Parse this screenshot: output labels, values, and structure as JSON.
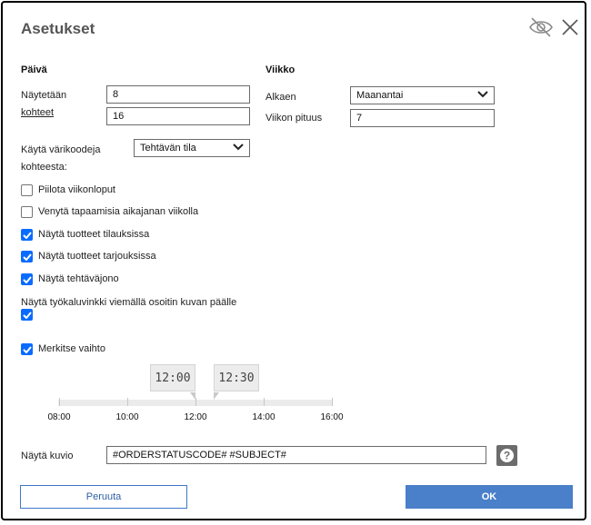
{
  "dialog": {
    "title": "Asetukset",
    "icons": {
      "hide": "eye-slash-icon",
      "close": "close-icon"
    }
  },
  "day": {
    "section": "Päivä",
    "shown_label_1": "Näytetään",
    "shown_label_2": "kohteet",
    "shown_value_1": "8",
    "shown_value_2": "16"
  },
  "week": {
    "section": "Viikko",
    "start_label": "Alkaen",
    "start_value": "Maanantai",
    "length_label": "Viikon pituus",
    "length_value": "7"
  },
  "colorcode": {
    "label_1": "Käytä värikoodeja",
    "label_2": "kohteesta:",
    "value": "Tehtävän tila"
  },
  "options": [
    {
      "label": "Piilota viikonloput",
      "checked": false
    },
    {
      "label": "Venytä tapaamisia aikajanan viikolla",
      "checked": false
    },
    {
      "label": "Näytä tuotteet tilauksissa",
      "checked": true
    },
    {
      "label": "Näytä tuotteet tarjouksissa",
      "checked": true
    },
    {
      "label": "Näytä tehtäväjono",
      "checked": true
    }
  ],
  "tooltip_option": {
    "label": "Näytä työkaluvinkki viemällä osoitin kuvan päälle",
    "checked": true
  },
  "shift_option": {
    "label": "Merkitse vaihto",
    "checked": true
  },
  "timeline": {
    "handle_start": "12:00",
    "handle_end": "12:30",
    "ticks": [
      "08:00",
      "10:00",
      "12:00",
      "14:00",
      "16:00"
    ],
    "range_start_hour": 8,
    "range_end_hour": 16,
    "handle_start_hour": 12,
    "handle_end_hour": 12.5
  },
  "pattern": {
    "label": "Näytä kuvio",
    "value": "#ORDERSTATUSCODE# #SUBJECT#",
    "help": "?"
  },
  "buttons": {
    "cancel": "Peruuta",
    "ok": "OK"
  },
  "colors": {
    "accent": "#0a6cff",
    "ok_button": "#4a7fc9",
    "cancel_border": "#3e78c8"
  }
}
